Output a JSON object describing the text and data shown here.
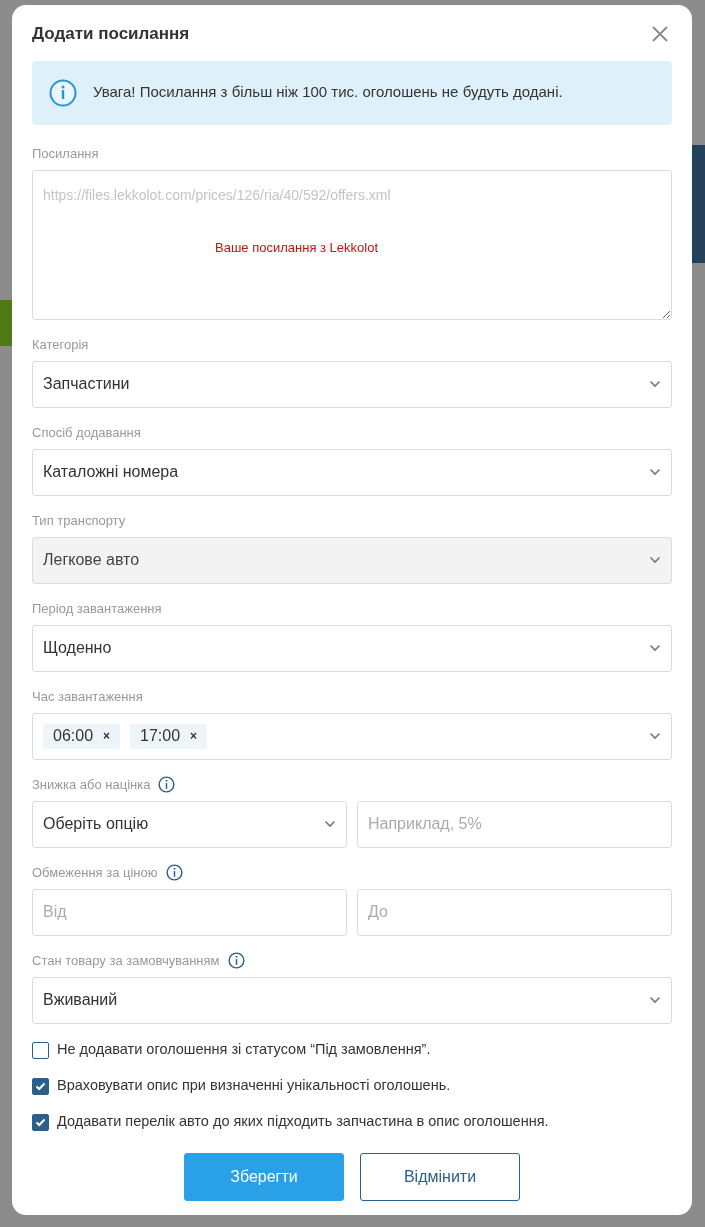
{
  "dialog": {
    "title": "Додати посилання"
  },
  "alert": {
    "text": "Увага! Посилання з більш ніж 100 тис. оголошень не будуть додані."
  },
  "link_field": {
    "label": "Посилання",
    "value": "https://files.lekkolot.com/prices/126/ria/40/592/offers.xml",
    "annotation": "Ваше посилання з Lekkolot"
  },
  "fields": [
    {
      "kind": "select",
      "label": "Категорія",
      "value": "Запчастини",
      "disabled": false
    },
    {
      "kind": "select",
      "label": "Спосіб додавання",
      "value": "Каталожні номера",
      "disabled": false
    },
    {
      "kind": "select",
      "label": "Тип транспорту",
      "value": "Легкове авто",
      "disabled": true
    },
    {
      "kind": "select",
      "label": "Період завантаження",
      "value": "Щоденно",
      "disabled": false
    },
    {
      "kind": "tags",
      "label": "Час завантаження",
      "tags": [
        "06:00",
        "17:00"
      ],
      "remove_symbol": "×"
    },
    {
      "kind": "pair",
      "label": "Знижка або націнка",
      "info": true,
      "left": {
        "kind": "select",
        "value": "Оберіть опцію"
      },
      "right": {
        "kind": "input",
        "placeholder": "Наприклад, 5%"
      }
    },
    {
      "kind": "pair",
      "label": "Обмеження за ціною",
      "info": true,
      "left": {
        "kind": "input",
        "placeholder": "Від"
      },
      "right": {
        "kind": "input",
        "placeholder": "До"
      }
    },
    {
      "kind": "select",
      "label": "Стан товару за замовчуванням",
      "info": true,
      "value": "Вживаний",
      "disabled": false
    }
  ],
  "checkboxes": [
    {
      "label": "Не додавати оголошення зі статусом “Під замовлення”.",
      "checked": false
    },
    {
      "label": "Враховувати опис при визначенні унікальності оголошень.",
      "checked": true
    },
    {
      "label": "Додавати перелік авто до яких підходить запчастина в опис оголошення.",
      "checked": true
    }
  ],
  "buttons": [
    {
      "kind": "primary",
      "label": "Зберегти"
    },
    {
      "kind": "secondary",
      "label": "Відмінити"
    }
  ]
}
